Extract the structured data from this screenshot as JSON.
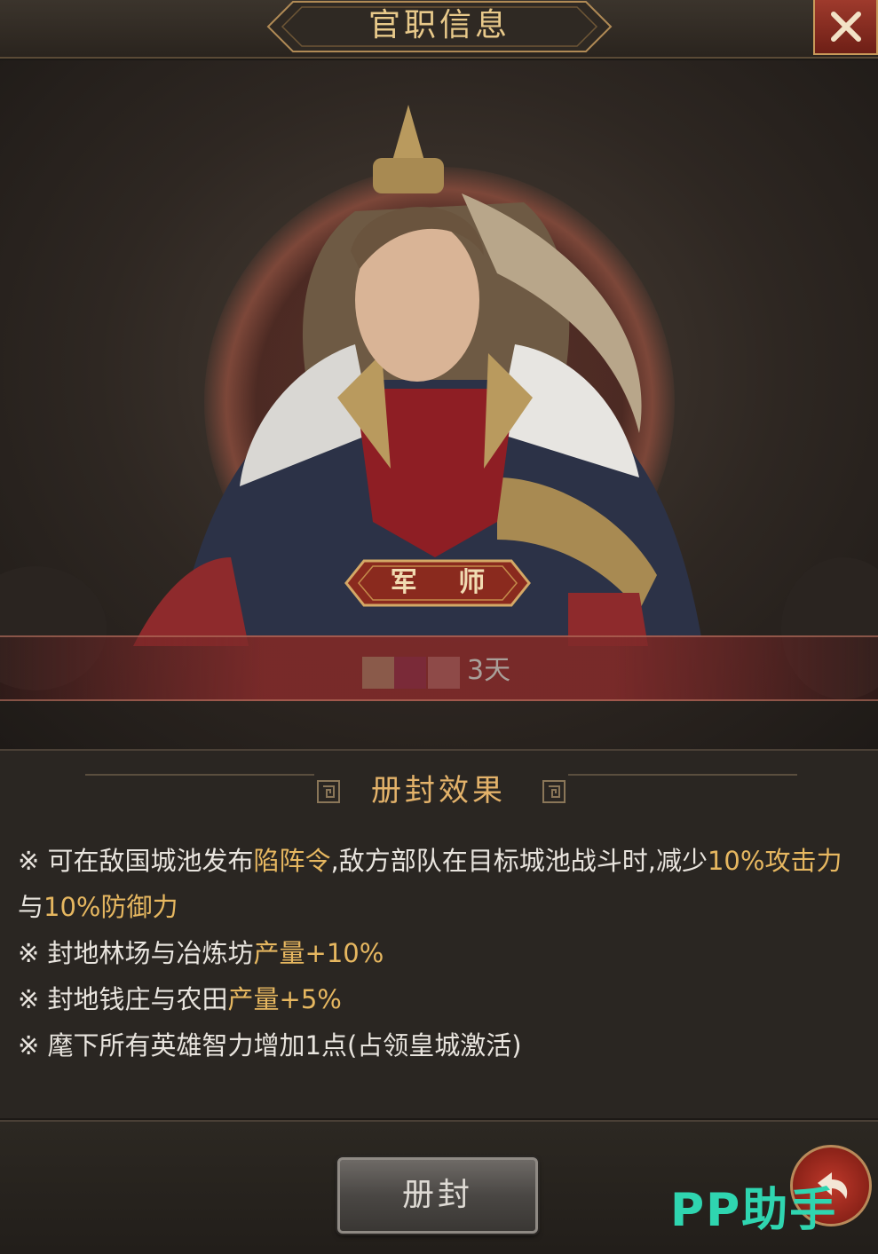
{
  "header": {
    "title": "官职信息"
  },
  "portrait": {
    "rank": "军 师",
    "duration": "3天"
  },
  "effects": {
    "title": "册封效果",
    "items": [
      {
        "segments": [
          {
            "text": "※ 可在敌国城池发布",
            "hl": false
          },
          {
            "text": "陷阵令",
            "hl": true
          },
          {
            "text": ",敌方部队在目标城池战斗时,减少",
            "hl": false
          },
          {
            "text": "10%攻击力",
            "hl": true
          },
          {
            "text": "与",
            "hl": false
          },
          {
            "text": "10%防御力",
            "hl": true
          }
        ]
      },
      {
        "segments": [
          {
            "text": "※ 封地林场与冶炼坊",
            "hl": false
          },
          {
            "text": "产量+10%",
            "hl": true
          }
        ]
      },
      {
        "segments": [
          {
            "text": "※ 封地钱庄与农田",
            "hl": false
          },
          {
            "text": "产量+5%",
            "hl": true
          }
        ]
      },
      {
        "segments": [
          {
            "text": "※ 麾下所有英雄智力增加1点(占领皇城激活)",
            "hl": false
          }
        ]
      }
    ]
  },
  "footer": {
    "confirm_label": "册封",
    "watermark": "PP助手"
  },
  "colors": {
    "gold": "#e6b760",
    "title_gold": "#e8c98a",
    "close_red": "#9e3a2c",
    "band_red": "#802a2a",
    "watermark": "#2fd5b0"
  },
  "icons": {
    "close": "close-icon",
    "back": "back-arrow-icon",
    "deco": "fret-ornament-icon"
  }
}
